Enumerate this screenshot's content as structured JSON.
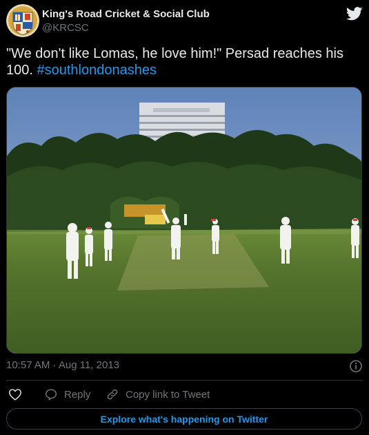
{
  "author": {
    "name": "King's Road Cricket & Social Club",
    "handle": "@KRCSC",
    "avatar_icon": "club-crest-avatar"
  },
  "tweet": {
    "text": "\"We don't like Lomas, he love him!\" Persad reaches his 100. ",
    "hashtag": "#southlondonashes",
    "image_alt": "cricket-match-photo"
  },
  "meta": {
    "timestamp": "10:57 AM · Aug 11, 2013",
    "info_icon": "info-icon"
  },
  "actions": {
    "like_icon": "heart-icon",
    "reply_label": "Reply",
    "reply_icon": "speech-bubble-icon",
    "copy_label": "Copy link to Tweet",
    "copy_icon": "link-icon"
  },
  "explore": {
    "label": "Explore what's happening on Twitter"
  },
  "colors": {
    "background": "#000000",
    "text": "#e7e9ea",
    "secondary": "#71767b",
    "accent": "#1d9bf0",
    "border": "#2f3336"
  }
}
